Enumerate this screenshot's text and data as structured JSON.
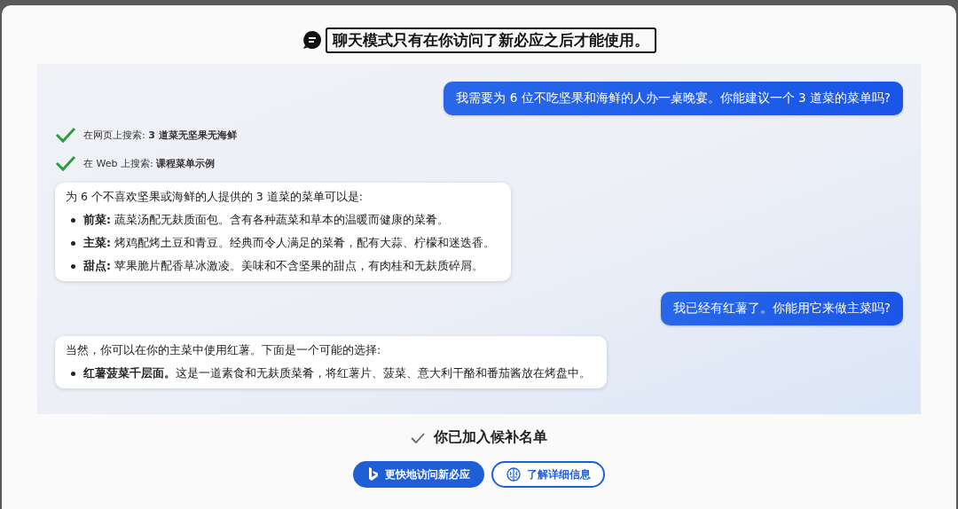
{
  "header": {
    "title": "聊天模式只有在你访问了新必应之后才能使用。"
  },
  "conversation": [
    {
      "kind": "user",
      "text": "我需要为 6 位不吃坚果和海鲜的人办一桌晚宴。你能建议一个 3 道菜的菜单吗?"
    },
    {
      "kind": "search",
      "text": "在网页上搜索: **3 道菜无坚果无海鲜**"
    },
    {
      "kind": "search",
      "text": "在 Web 上搜索: **课程菜单示例**"
    },
    {
      "kind": "answer",
      "intro": "为 6 个不喜欢坚果或海鲜的人提供的 3 道菜的菜单可以是:",
      "items": [
        "**前菜:** 蔬菜汤配无麸质面包。含有各种蔬菜和草本的温暖而健康的菜肴。",
        "**主菜:** 烤鸡配烤土豆和青豆。经典而令人满足的菜肴，配有大蒜、柠檬和迷迭香。",
        "**甜点:** 苹果脆片配香草冰激凌。美味和不含坚果的甜点，有肉桂和无麸质碎屑。"
      ]
    },
    {
      "kind": "user",
      "text": "我已经有红薯了。你能用它来做主菜吗?"
    },
    {
      "kind": "answer",
      "intro": "当然，你可以在你的主菜中使用红薯。下面是一个可能的选择:",
      "items": [
        "**红薯菠菜千层面。**这是一道素食和无麸质菜肴，将红薯片、菠菜、意大利干酪和番茄酱放在烤盘中。"
      ]
    }
  ],
  "status": {
    "text": "你已加入候补名单"
  },
  "buttons": [
    {
      "kind": "primary",
      "label": "更快地访问新必应"
    },
    {
      "kind": "secondary",
      "label": "了解详细信息"
    }
  ]
}
